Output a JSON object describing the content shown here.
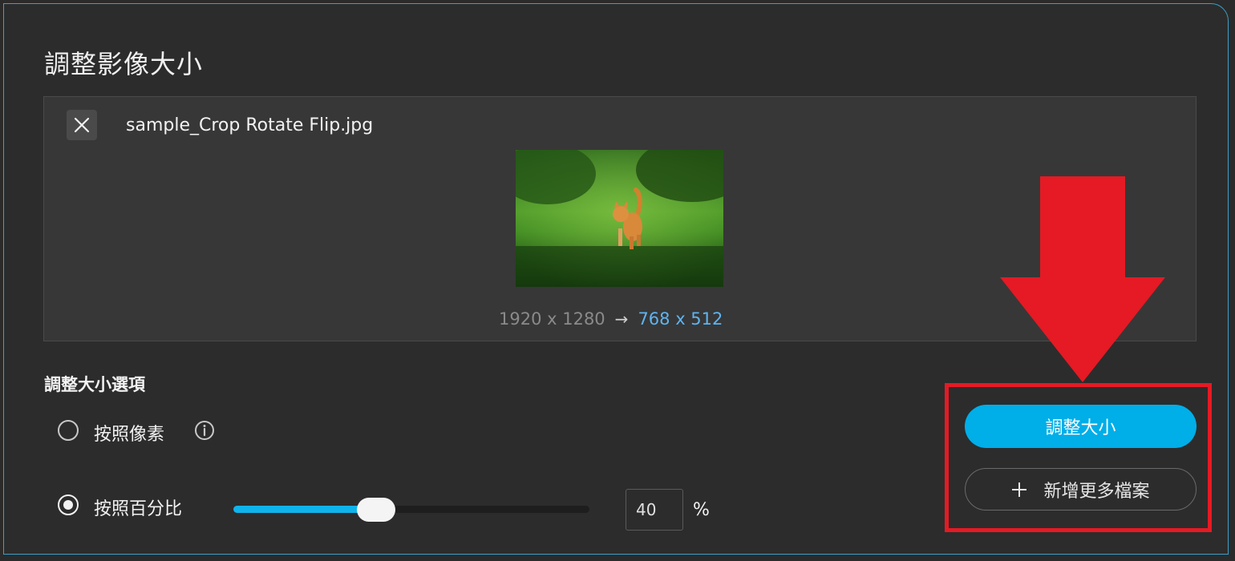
{
  "dialog": {
    "title": "調整影像大小"
  },
  "preview": {
    "filename": "sample_Crop Rotate Flip.jpg",
    "original_size": "1920 x 1280",
    "new_size": "768 x 512"
  },
  "options": {
    "section_title": "調整大小選項",
    "by_pixel_label": "按照像素",
    "by_percent_label": "按照百分比",
    "selected": "by_percent",
    "percent_value": "40",
    "percent_sign": "%",
    "slider_fraction": 0.4
  },
  "actions": {
    "resize_label": "調整大小",
    "add_more_label": "新增更多檔案"
  },
  "colors": {
    "accent": "#00aee8",
    "annotation_red": "#e51a24",
    "new_size_text": "#5fb4f0"
  },
  "icons": {
    "close": "close-icon",
    "info": "info-icon",
    "arrow": "arrow-right-icon",
    "add": "plus-icon"
  }
}
